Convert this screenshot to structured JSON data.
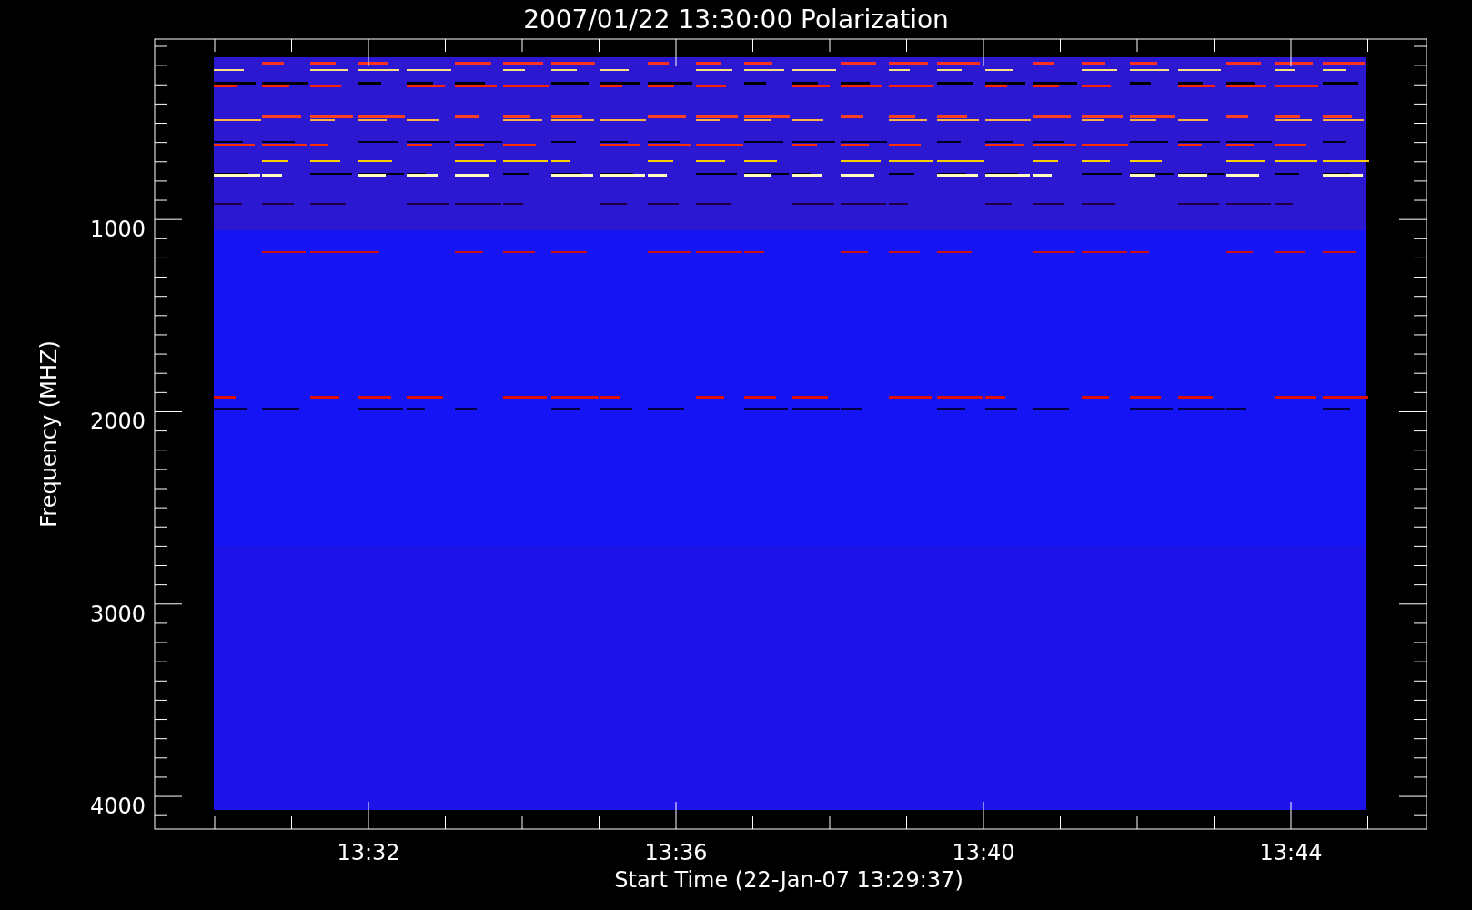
{
  "title": "2007/01/22 13:30:00 Polarization",
  "y_axis": {
    "label": "Frequency (MHZ)",
    "ticks": [
      "1000",
      "2000",
      "3000",
      "4000"
    ]
  },
  "x_axis": {
    "label": "Start Time (22-Jan-07 13:29:37)",
    "ticks": [
      "13:32",
      "13:36",
      "13:40",
      "13:44"
    ]
  }
}
